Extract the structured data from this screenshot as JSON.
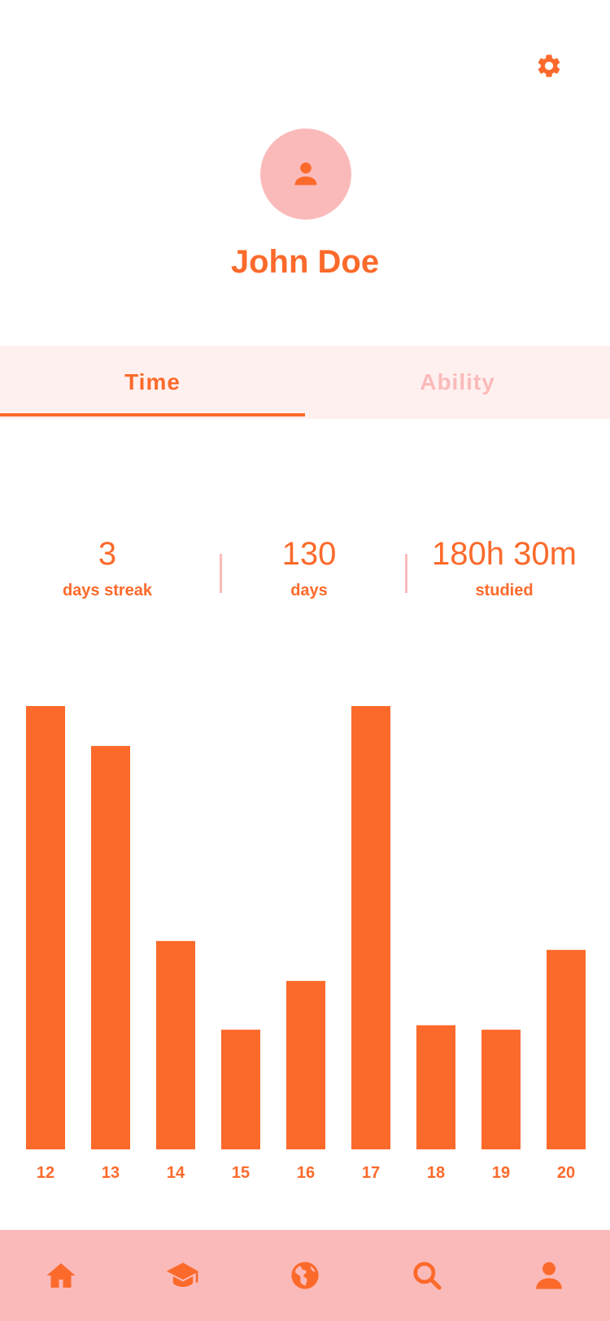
{
  "profile": {
    "name": "John Doe",
    "avatar_icon": "person-icon",
    "settings_icon": "gear-icon"
  },
  "tabs": [
    {
      "label": "Time",
      "active": true
    },
    {
      "label": "Ability",
      "active": false
    }
  ],
  "stats": [
    {
      "value": "3",
      "label": "days streak"
    },
    {
      "value": "130",
      "label": "days"
    },
    {
      "value": "180h 30m",
      "label": "studied"
    }
  ],
  "chart_data": {
    "type": "bar",
    "categories": [
      "12",
      "13",
      "14",
      "15",
      "16",
      "17",
      "18",
      "19",
      "20"
    ],
    "values": [
      100,
      91,
      47,
      27,
      38,
      100,
      28,
      27,
      45
    ],
    "ylim": [
      0,
      100
    ],
    "title": "",
    "xlabel": "",
    "ylabel": "",
    "grid": false,
    "bar_color": "#fc6a2b"
  },
  "bottom_nav": [
    {
      "icon": "home-icon"
    },
    {
      "icon": "graduation-cap-icon"
    },
    {
      "icon": "globe-icon"
    },
    {
      "icon": "search-icon"
    },
    {
      "icon": "user-icon"
    }
  ],
  "colors": {
    "accent": "#fc6a2b",
    "soft": "#fbbaba",
    "tab_bg": "#fff0f0"
  }
}
